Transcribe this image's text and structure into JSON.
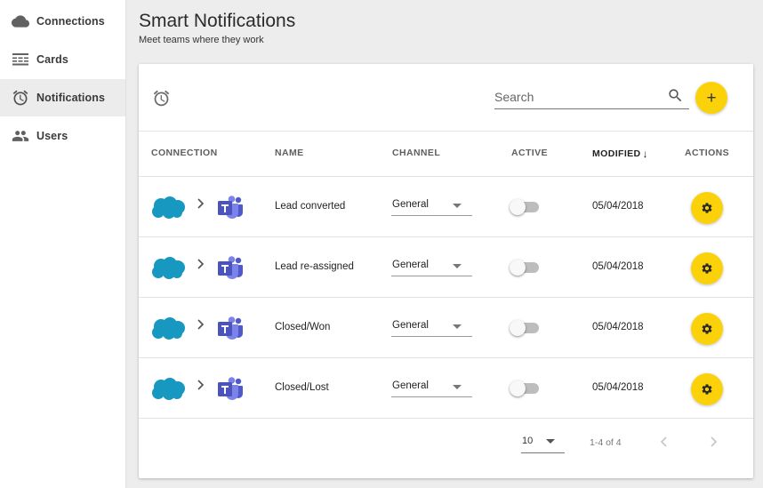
{
  "sidebar": {
    "items": [
      {
        "label": "Connections",
        "icon": "cloud-icon"
      },
      {
        "label": "Cards",
        "icon": "cards-icon"
      },
      {
        "label": "Notifications",
        "icon": "alarm-clock-icon",
        "active": true
      },
      {
        "label": "Users",
        "icon": "users-icon"
      }
    ]
  },
  "header": {
    "title": "Smart Notifications",
    "subtitle": "Meet teams where they work"
  },
  "toolbar": {
    "alarm_icon": "alarm-clock-icon",
    "search_placeholder": "Search",
    "search_value": "",
    "search_icon": "search-icon",
    "add_label": "+"
  },
  "table": {
    "columns": {
      "connection": "CONNECTION",
      "name": "NAME",
      "channel": "CHANNEL",
      "active": "ACTIVE",
      "modified": "MODIFIED",
      "actions": "ACTIONS"
    },
    "sort": {
      "column": "modified",
      "direction": "desc",
      "icon": "arrow-down-icon"
    },
    "rows": [
      {
        "source": "salesforce-logo",
        "target": "teams-logo",
        "name": "Lead converted",
        "channel": "General",
        "active": false,
        "modified": "05/04/2018"
      },
      {
        "source": "salesforce-logo",
        "target": "teams-logo",
        "name": "Lead re-assigned",
        "channel": "General",
        "active": false,
        "modified": "05/04/2018"
      },
      {
        "source": "salesforce-logo",
        "target": "teams-logo",
        "name": "Closed/Won",
        "channel": "General",
        "active": false,
        "modified": "05/04/2018"
      },
      {
        "source": "salesforce-logo",
        "target": "teams-logo",
        "name": "Closed/Lost",
        "channel": "General",
        "active": false,
        "modified": "05/04/2018"
      }
    ]
  },
  "pagination": {
    "page_size": "10",
    "range": "1-4 of 4"
  },
  "colors": {
    "accent": "#fbd20a",
    "salesforce": "#1798c1",
    "teams": "#5059c9",
    "background": "#ededed"
  }
}
